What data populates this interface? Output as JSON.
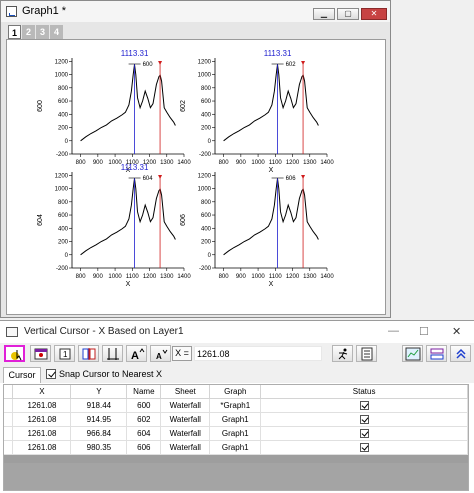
{
  "graph_window": {
    "title": "Graph1 *",
    "min_button": "▁",
    "max_button": "▢",
    "close_button": "✕",
    "layer_tabs": [
      "1",
      "2",
      "3",
      "4"
    ],
    "active_layer_tab": 0
  },
  "chart_data": [
    {
      "type": "line",
      "series": [
        {
          "name": "600",
          "values": []
        }
      ],
      "xlabel": "X",
      "ylabel": "600",
      "xlim": [
        750,
        1400
      ],
      "ylim": [
        -200,
        1250
      ],
      "xticks": [
        "800",
        "900",
        "1000",
        "1100",
        "1200",
        "1300",
        "1400"
      ],
      "yticks": [
        "-200",
        "0",
        "200",
        "400",
        "600",
        "800",
        "1000",
        "1200"
      ],
      "cursor_readout": "1113.31",
      "cursor_label": "600",
      "blue_cursor_x": 1113.31,
      "red_cursor_x": 1261.08
    },
    {
      "type": "line",
      "series": [
        {
          "name": "602",
          "values": []
        }
      ],
      "xlabel": "X",
      "ylabel": "602",
      "xlim": [
        750,
        1400
      ],
      "ylim": [
        -200,
        1250
      ],
      "xticks": [
        "800",
        "900",
        "1000",
        "1100",
        "1200",
        "1300",
        "1400"
      ],
      "yticks": [
        "-200",
        "0",
        "200",
        "400",
        "600",
        "800",
        "1000",
        "1200"
      ],
      "cursor_readout": "1113.31",
      "cursor_label": "602",
      "blue_cursor_x": 1113.31,
      "red_cursor_x": 1261.08
    },
    {
      "type": "line",
      "series": [
        {
          "name": "604",
          "values": []
        }
      ],
      "xlabel": "X",
      "ylabel": "604",
      "xlim": [
        750,
        1400
      ],
      "ylim": [
        -200,
        1250
      ],
      "xticks": [
        "800",
        "900",
        "1000",
        "1100",
        "1200",
        "1300",
        "1400"
      ],
      "yticks": [
        "-200",
        "0",
        "200",
        "400",
        "600",
        "800",
        "1000",
        "1200"
      ],
      "cursor_readout": "1113.31",
      "cursor_label": "604",
      "blue_cursor_x": 1113.31,
      "red_cursor_x": 1261.08
    },
    {
      "type": "line",
      "series": [
        {
          "name": "606",
          "values": []
        }
      ],
      "xlabel": "X",
      "ylabel": "606",
      "xlim": [
        750,
        1400
      ],
      "ylim": [
        -200,
        1250
      ],
      "xticks": [
        "800",
        "900",
        "1000",
        "1100",
        "1200",
        "1300",
        "1400"
      ],
      "yticks": [
        "-200",
        "0",
        "200",
        "400",
        "600",
        "800",
        "1000",
        "1200"
      ],
      "cursor_readout": "",
      "cursor_label": "606",
      "blue_cursor_x": 1113.31,
      "red_cursor_x": 1261.08
    }
  ],
  "spectrum_x": [
    800,
    830,
    860,
    890,
    920,
    950,
    980,
    1010,
    1040,
    1060,
    1080,
    1095,
    1105,
    1113,
    1120,
    1130,
    1145,
    1160,
    1175,
    1190,
    1205,
    1220,
    1240,
    1255,
    1262,
    1270,
    1285,
    1300,
    1320,
    1340,
    1350
  ],
  "spectrum_y": [
    0,
    60,
    110,
    150,
    200,
    240,
    300,
    340,
    390,
    430,
    540,
    750,
    1000,
    1150,
    1000,
    650,
    500,
    600,
    750,
    640,
    500,
    560,
    850,
    970,
    990,
    900,
    500,
    430,
    350,
    280,
    230
  ],
  "cursor_window": {
    "title": "Vertical Cursor - X Based on Layer1",
    "controls": [
      "—",
      "☐",
      "✕"
    ],
    "x_label": "X =",
    "x_value": "1261.08",
    "tab_label": "Cursor",
    "snap_label": "Snap Cursor to Nearest X",
    "columns": [
      "X",
      "Y",
      "Name",
      "Sheet",
      "Graph",
      "Status"
    ],
    "rows": [
      {
        "x": "1261.08",
        "y": "918.44",
        "name": "600",
        "sheet": "Waterfall",
        "graph": "*Graph1"
      },
      {
        "x": "1261.08",
        "y": "914.95",
        "name": "602",
        "sheet": "Waterfall",
        "graph": "Graph1"
      },
      {
        "x": "1261.08",
        "y": "966.84",
        "name": "604",
        "sheet": "Waterfall",
        "graph": "Graph1"
      },
      {
        "x": "1261.08",
        "y": "980.35",
        "name": "606",
        "sheet": "Waterfall",
        "graph": "Graph1"
      }
    ]
  },
  "colors": {
    "blue_cursor": "#1e1ecf",
    "red_cursor": "#d01c1c",
    "selected_tool_border": "#e020d8"
  }
}
